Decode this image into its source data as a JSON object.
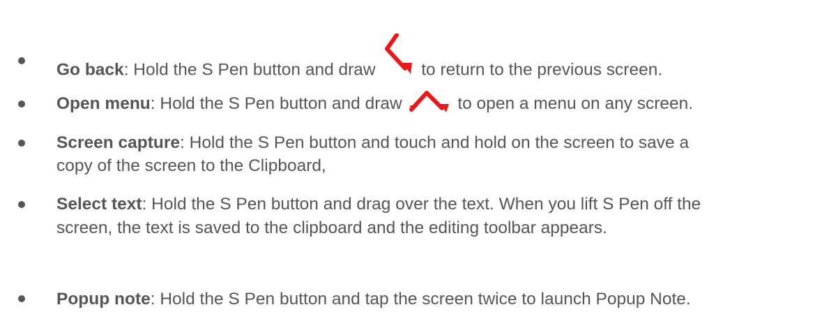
{
  "items": [
    {
      "term": "Go back",
      "pre": ": Hold the S Pen button and draw ",
      "post": " to return to the previous screen.",
      "gesture_icon": "back-chevron-gesture",
      "gesture_color": "#e8191b"
    },
    {
      "term": "Open menu",
      "pre": ": Hold the S Pen button and draw ",
      "post": " to open a menu on any screen.",
      "gesture_icon": "caret-up-gesture",
      "gesture_color": "#e8191b"
    },
    {
      "term": "Screen capture",
      "line1": ": Hold the S Pen button and touch and hold on the screen to save a",
      "line2": "copy of the screen to the Clipboard,"
    },
    {
      "term": "Select text",
      "line1": ": Hold the S Pen button and drag over the text. When you lift S Pen off the",
      "line2": "screen, the text is saved to the clipboard and the editing toolbar appears."
    },
    {
      "term": "Popup note",
      "line1": ": Hold the S Pen button and tap the screen twice to launch Popup Note."
    }
  ],
  "colors": {
    "text": "#555555",
    "gesture": "#e8191b"
  }
}
